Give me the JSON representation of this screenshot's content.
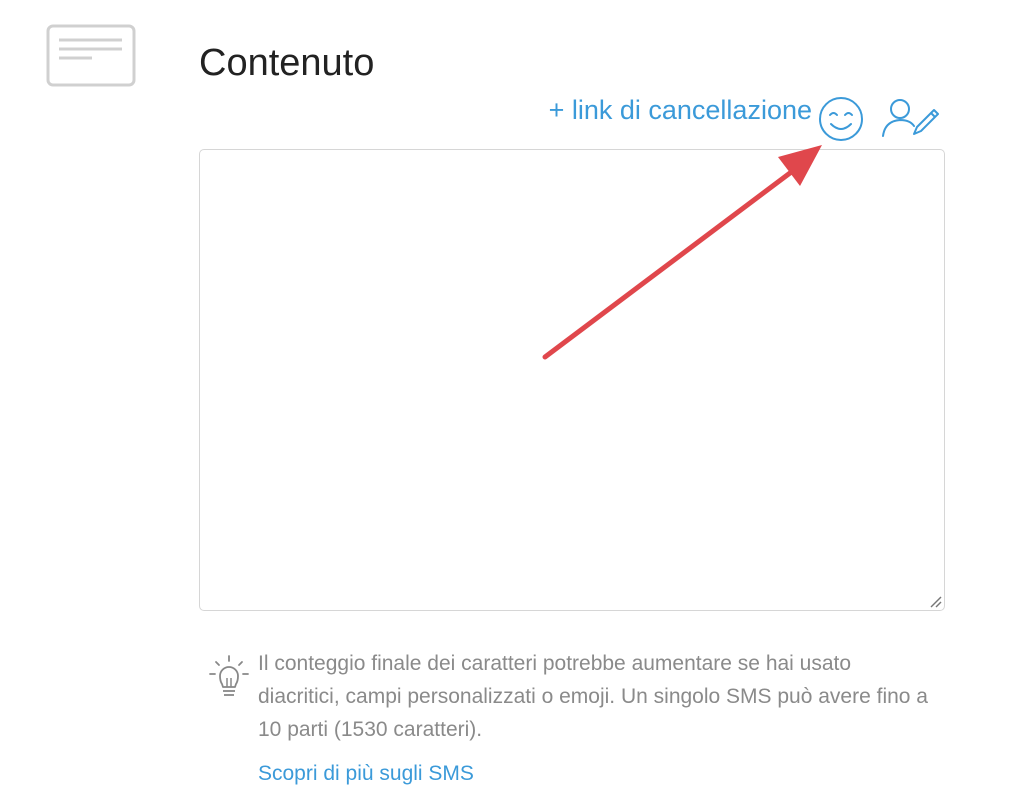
{
  "section": {
    "icon": "message-card-icon",
    "title": "Contenuto"
  },
  "toolbar": {
    "unsubscribe_link_label": "+ link di cancellazione",
    "emoji_icon": "smiley-face-icon",
    "personalize_icon": "user-pen-icon"
  },
  "editor": {
    "value": "",
    "placeholder": ""
  },
  "tip": {
    "icon": "lightbulb-icon",
    "text": "Il conteggio finale dei caratteri potrebbe aumentare se hai usato diacritici, campi personalizzati o emoji. Un singolo SMS può avere fino a 10 parti (1530 caratteri).",
    "learn_more_label": "Scopri di più sugli SMS"
  },
  "annotation": {
    "arrow_color": "#e0474c"
  },
  "colors": {
    "accent": "#3b9ad9",
    "muted_text": "#8a8a8a",
    "title_text": "#222222",
    "border": "#d6d6d6"
  }
}
